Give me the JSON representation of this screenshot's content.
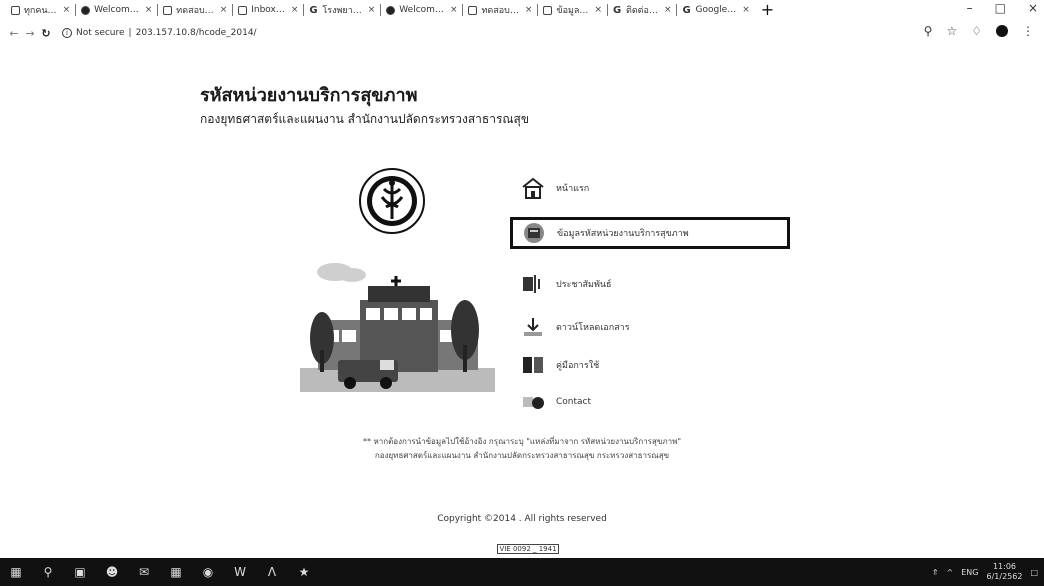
{
  "browser": {
    "tabs": [
      {
        "label": "ทุกคน…",
        "icon": "page-icon"
      },
      {
        "label": "Welcom…",
        "icon": "globe-icon"
      },
      {
        "label": "ทดสอบ…",
        "icon": "page-icon"
      },
      {
        "label": "Inbox…",
        "icon": "mail-icon"
      },
      {
        "label": "โรงพยา…",
        "icon": "google-icon"
      },
      {
        "label": "Welcom…",
        "icon": "globe-icon"
      },
      {
        "label": "ทดสอบ…",
        "icon": "page-icon"
      },
      {
        "label": "ข้อมูล…",
        "icon": "grid-icon"
      },
      {
        "label": "ติดต่อ…",
        "icon": "google-icon"
      },
      {
        "label": "Google…",
        "icon": "google-icon"
      }
    ],
    "new_tab": "+",
    "minimize": "–",
    "maximize": "□",
    "close": "×",
    "security_label": "Not secure",
    "url": "203.157.10.8/hcode_2014/"
  },
  "page": {
    "title": "รหัสหน่วยงานบริการสุขภาพ",
    "subtitle": "กองยุทธศาสตร์และแผนงาน สำนักงานปลัดกระทรวงสาธารณสุข",
    "menu": [
      {
        "label": "หน้าแรก",
        "icon": "home-icon",
        "active": false
      },
      {
        "label": "ข้อมูลรหัสหน่วยงานบริการสุขภาพ",
        "icon": "database-icon",
        "active": true
      },
      {
        "label": "ประชาสัมพันธ์",
        "icon": "news-icon",
        "active": false
      },
      {
        "label": "ดาวน์โหลดเอกสาร",
        "icon": "download-icon",
        "active": false
      },
      {
        "label": "คู่มือการใช้",
        "icon": "manual-icon",
        "active": false
      },
      {
        "label": "Contact",
        "icon": "contact-icon",
        "active": false
      }
    ],
    "note_line1": "** หากต้องการนำข้อมูลไปใช้อ้างอิง กรุณาระบุ \"แหล่งที่มาจาก รหัสหน่วยงานบริการสุขภาพ\"",
    "note_line2": "กองยุทธศาสตร์และแผนงาน สำนักงานปลัดกระทรวงสาธารณสุข กระทรวงสาธารณสุข",
    "copyright": "Copyright ©2014 . All rights reserved",
    "counter": "VIE 0092  _ 1941"
  },
  "taskbar": {
    "items": [
      "start-icon",
      "search-icon",
      "task-view-icon",
      "people-icon",
      "mail-icon",
      "photos-icon",
      "chrome-icon",
      "word-icon",
      "acrobat-icon",
      "game-icon"
    ],
    "tray_lang": "ENG",
    "time": "11:06",
    "date": "6/1/2562"
  }
}
